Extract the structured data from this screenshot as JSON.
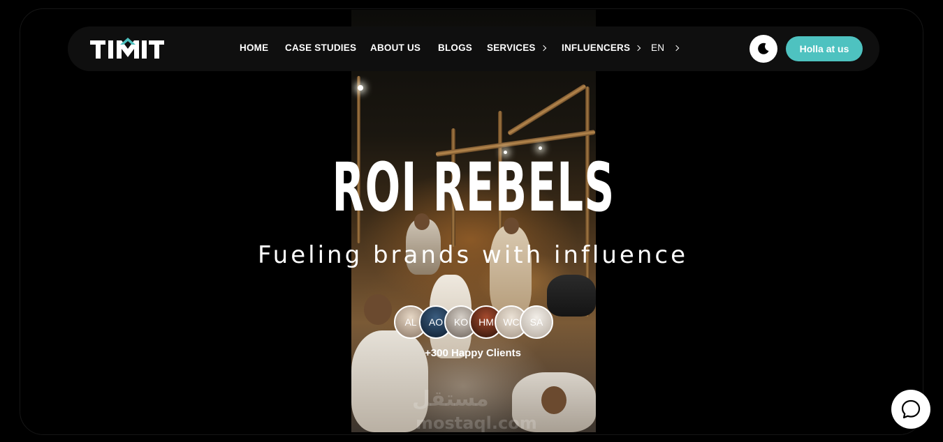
{
  "brand": {
    "logo_text": "TIMT"
  },
  "nav": {
    "items": [
      {
        "label": "HOME",
        "has_chevron": false
      },
      {
        "label": "CASE STUDIES",
        "has_chevron": false
      },
      {
        "label": "ABOUT US",
        "has_chevron": false
      },
      {
        "label": "BLOGS",
        "has_chevron": false
      },
      {
        "label": "SERVICES",
        "has_chevron": true
      },
      {
        "label": "INFLUENCERS",
        "has_chevron": true
      }
    ],
    "language": "EN",
    "theme_toggle_icon": "moon-icon",
    "cta_label": "Holla at us"
  },
  "hero": {
    "title": "ROI REBELS",
    "subtitle": "Fueling brands with influence",
    "avatars": [
      "AL",
      "AO",
      "KO",
      "HM",
      "WC",
      "SA"
    ],
    "clients_label": "+300 Happy Clients"
  },
  "watermark": {
    "line1": "مستقل",
    "line2": "mostaql.com"
  },
  "chat": {
    "icon": "chat-bubble-icon"
  },
  "colors": {
    "accent": "#4ec2c0",
    "background": "#000000",
    "nav_bg": "#0f0f0f"
  }
}
